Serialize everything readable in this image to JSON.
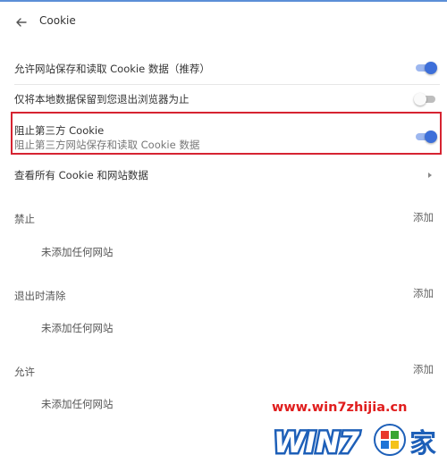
{
  "header": {
    "title": "Cookie"
  },
  "settings": {
    "allow_sites": {
      "label": "允许网站保存和读取 Cookie 数据（推荐）",
      "enabled": true
    },
    "keep_local_until_quit": {
      "label": "仅将本地数据保留到您退出浏览器为止",
      "enabled": false
    },
    "block_third_party": {
      "label": "阻止第三方 Cookie",
      "description": "阻止第三方网站保存和读取 Cookie 数据",
      "enabled": true
    },
    "see_all": {
      "label": "查看所有 Cookie 和网站数据"
    }
  },
  "sections": {
    "block": {
      "title": "禁止",
      "add_label": "添加",
      "empty_text": "未添加任何网站"
    },
    "clear_on_exit": {
      "title": "退出时清除",
      "add_label": "添加",
      "empty_text": "未添加任何网站"
    },
    "allow": {
      "title": "允许",
      "add_label": "添加",
      "empty_text": "未添加任何网站"
    }
  },
  "watermark": {
    "url": "www.win7zhijia.cn",
    "logo_text": "WIN7",
    "logo_suffix": "家"
  },
  "colors": {
    "accent": "#3d6fd9",
    "highlight": "#d62331",
    "watermark": "#e01d1d",
    "logo_blue": "#1d5fb8"
  }
}
